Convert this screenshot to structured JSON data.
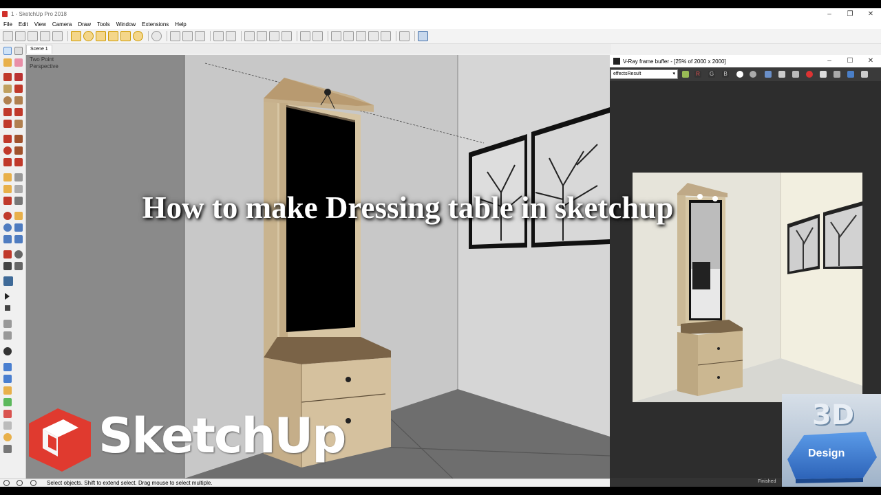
{
  "window": {
    "title": "1 - SketchUp Pro 2018",
    "controls": [
      "–",
      "❐",
      "✕"
    ]
  },
  "menu": [
    "File",
    "Edit",
    "View",
    "Camera",
    "Draw",
    "Tools",
    "Window",
    "Extensions",
    "Help"
  ],
  "scene_tabs": [
    "Scene 1"
  ],
  "viewport": {
    "camera_label_1": "Two Point",
    "camera_label_2": "Perspective"
  },
  "vray": {
    "title": "V-Ray frame buffer - [25% of 2000 x 2000]",
    "controls": [
      "–",
      "☐",
      "✕"
    ],
    "channel_select": "effectsResult",
    "channel_buttons": [
      "R",
      "G",
      "B"
    ],
    "status": "Finished"
  },
  "statusbar": {
    "message": "Select objects. Shift to extend select. Drag mouse to select multiple."
  },
  "overlay": {
    "headline": "How to make Dressing table in sketchup",
    "brand": "SketchUp",
    "badge_top": "3D",
    "badge_bottom": "Design"
  },
  "colors": {
    "sketchup_red": "#e03a2f",
    "wood": "#d3c3a4",
    "vray_bg": "#2d2d2d",
    "badge_blue": "#3f7fd0"
  }
}
